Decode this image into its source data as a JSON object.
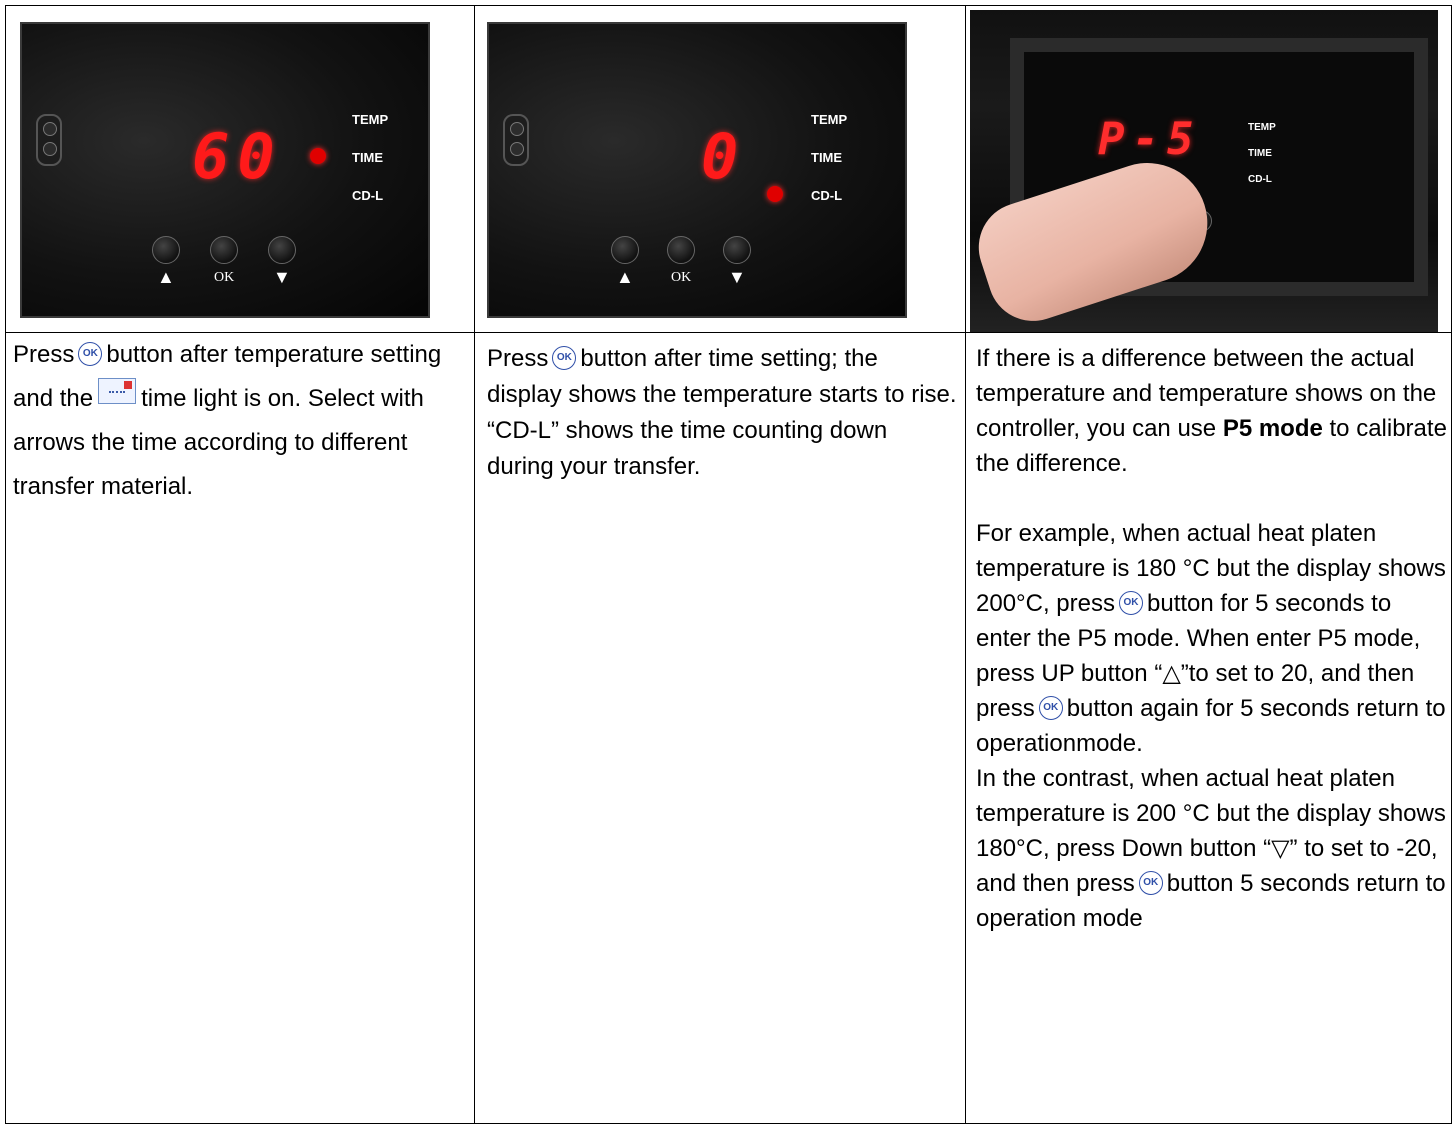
{
  "panels": [
    {
      "display": "60",
      "active_indicator": "TIME",
      "labels": [
        "TEMP",
        "TIME",
        "CD-L"
      ],
      "buttons": [
        "▲",
        "OK",
        "▼"
      ]
    },
    {
      "display": "0",
      "active_indicator": "CD-L",
      "labels": [
        "TEMP",
        "TIME",
        "CD-L"
      ],
      "buttons": [
        "▲",
        "OK",
        "▼"
      ]
    },
    {
      "display": "P-5",
      "labels": [
        "TEMP",
        "TIME",
        "CD-L"
      ]
    }
  ],
  "col1": {
    "t1": "Press",
    "t2": "button after temperature setting and the",
    "t3": "time light is on. Select with arrows the time according to different transfer material."
  },
  "col2": {
    "t1": "Press",
    "t2": "button after time setting; the display shows the temperature starts to rise. “CD-L” shows the time counting down during your transfer."
  },
  "col3": {
    "p1a": "If there is a difference between the actual temperature and temperature shows on the controller, you can use",
    "p1b": "P5 mode",
    "p1c": "to calibrate the difference.",
    "p2a": "For example, when actual heat platen temperature is 180 °C but the display shows 200°C, press",
    "p2b": "button for 5 seconds to enter the P5 mode.   When enter P5 mode, press UP button  “△”to set to 20, and then press",
    "p2c": "button again for 5 seconds return to operationmode.",
    "p3a": "In the contrast, when actual heat platen temperature is 200 °C but the display shows 180°C, press Down button  “▽”  to set to -20, and then press",
    "p3b": "button 5 seconds return to operation mode"
  },
  "icons": {
    "ok_label": "OK",
    "ok_color": "#2f4fa8",
    "display_color": "#ff1a1a"
  }
}
